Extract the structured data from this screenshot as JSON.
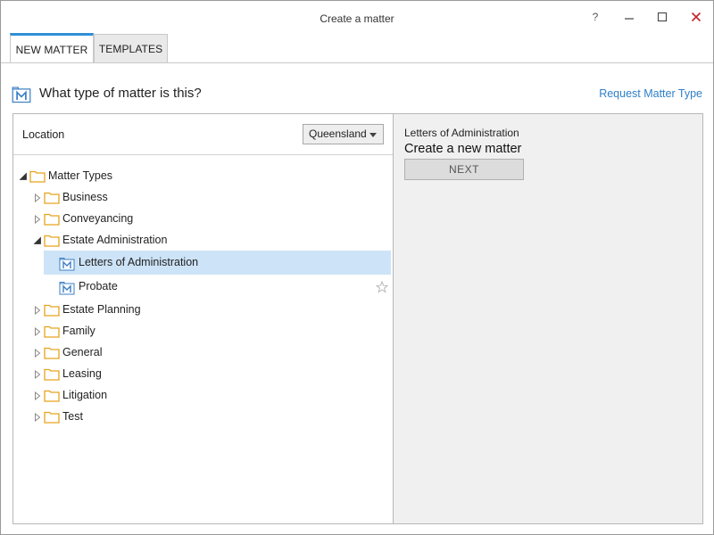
{
  "window": {
    "title": "Create a matter",
    "help": "?",
    "minimize": "–",
    "maximize": "☐",
    "close": "✕"
  },
  "tabs": [
    {
      "label": "NEW MATTER",
      "active": true
    },
    {
      "label": "TEMPLATES",
      "active": false
    }
  ],
  "heading": {
    "text": "What type of matter is this?",
    "icon": "matter-icon",
    "request_link": "Request Matter Type"
  },
  "location": {
    "label": "Location",
    "selected": "Queensland"
  },
  "tree": {
    "root": "Matter Types",
    "items": [
      {
        "label": "Business",
        "expanded": false
      },
      {
        "label": "Conveyancing",
        "expanded": false
      },
      {
        "label": "Estate Administration",
        "expanded": true,
        "children": [
          {
            "label": "Letters of Administration",
            "selected": true
          },
          {
            "label": "Probate",
            "selected": false
          }
        ]
      },
      {
        "label": "Estate Planning",
        "expanded": false
      },
      {
        "label": "Family",
        "expanded": false
      },
      {
        "label": "General",
        "expanded": false
      },
      {
        "label": "Leasing",
        "expanded": false
      },
      {
        "label": "Litigation",
        "expanded": false
      },
      {
        "label": "Test",
        "expanded": false
      }
    ]
  },
  "detail": {
    "subtitle": "Letters of Administration",
    "title": "Create a new matter",
    "next_label": "NEXT"
  },
  "colors": {
    "accent": "#2f8fd6",
    "link": "#2f7fc8",
    "folder": "#e8a31e",
    "selection": "#cde3f7",
    "close": "#c4262e"
  }
}
